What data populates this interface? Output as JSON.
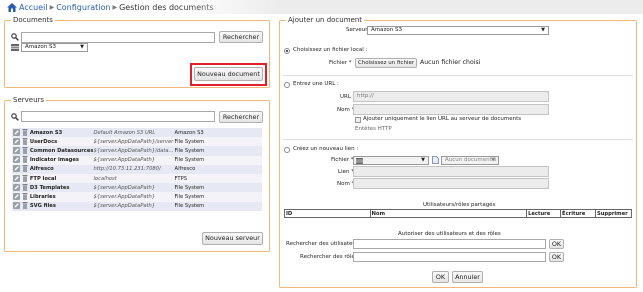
{
  "breadcrumb": {
    "home": "Accueil",
    "configuration": "Configuration",
    "current": "Gestion des documents"
  },
  "documents": {
    "legend": "Documents",
    "search_button": "Rechercher",
    "filter_selected": "Amazon S3",
    "new_button": "Nouveau document"
  },
  "servers": {
    "legend": "Serveurs",
    "search_button": "Rechercher",
    "rows": [
      {
        "name": "Amazon S3",
        "url": "Default Amazon S3 URL",
        "type": "Amazon S3"
      },
      {
        "name": "UserDocs",
        "url": "${server.AppDataPath}/server",
        "type": "File System"
      },
      {
        "name": "Common Datasources",
        "url": "${server.AppDataPath}/data...",
        "type": "File System"
      },
      {
        "name": "Indicator images",
        "url": "${server.AppDataPath}",
        "type": "File System"
      },
      {
        "name": "Alfresco",
        "url": "http://10.73.11.231:7080/",
        "type": "Alfresco"
      },
      {
        "name": "FTP local",
        "url": "localhost",
        "type": "FTPS"
      },
      {
        "name": "D3 Templates",
        "url": "${server.AppDataPath}",
        "type": "File System"
      },
      {
        "name": "Libraries",
        "url": "${server.AppDataPath}",
        "type": "File System"
      },
      {
        "name": "SVG files",
        "url": "${server.AppDataPath}",
        "type": "File System"
      }
    ],
    "new_button": "Nouveau serveur"
  },
  "add_document": {
    "legend": "Ajouter un document",
    "server_label": "Serveur:",
    "server_value": "Amazon S3",
    "local_file": {
      "radio_label": "Choisissez un fichier local :",
      "file_label": "Fichier *",
      "choose_button": "Choisissez un fichier",
      "no_file_text": "Aucun fichier choisi"
    },
    "url_section": {
      "radio_label": "Entrez une URL :",
      "url_label": "URL *",
      "url_value": "http://",
      "name_label": "Nom *",
      "checkbox_label": "Ajouter uniquement le lien URL au serveur de documents",
      "headers_label": "Entêtes HTTP"
    },
    "new_link": {
      "radio_label": "Créez un nouveau lien :",
      "file_label": "Fichier *",
      "doc_select": "Aucun document li",
      "link_label": "Lien *",
      "name_label": "Nom *"
    },
    "permissions": {
      "caption": "Utilisateurs/rôles partagés",
      "columns": [
        "ID",
        "Nom",
        "Lecture",
        "Écriture",
        "Supprimer"
      ]
    },
    "authorize": {
      "caption": "Autoriser des utilisateurs et des rôles",
      "users_label": "Rechercher des utilisateurs",
      "roles_label": "Rechercher des rôles",
      "ok_label": "OK"
    },
    "ok_button": "OK",
    "cancel_button": "Annuler"
  }
}
